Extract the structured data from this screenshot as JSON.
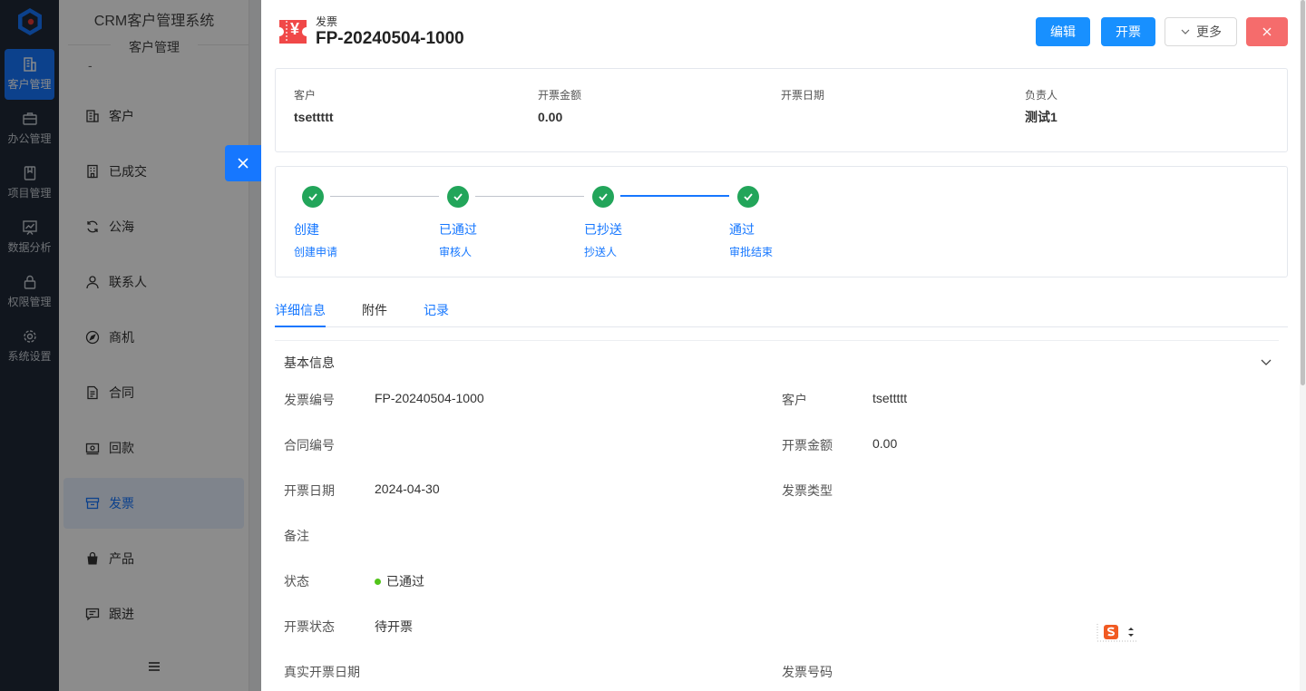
{
  "rail": {
    "items": [
      {
        "label": "客户管理",
        "icon": "building-icon",
        "active": true
      },
      {
        "label": "办公管理",
        "icon": "briefcase-icon"
      },
      {
        "label": "项目管理",
        "icon": "book-icon"
      },
      {
        "label": "数据分析",
        "icon": "chart-icon"
      },
      {
        "label": "权限管理",
        "icon": "lock-icon"
      },
      {
        "label": "系统设置",
        "icon": "gear-icon"
      }
    ]
  },
  "submenu": {
    "system_title": "CRM客户管理系统",
    "section_title": "客户管理",
    "dash": "-",
    "items": [
      {
        "label": "客户",
        "icon": "building-icon"
      },
      {
        "label": "已成交",
        "icon": "office-icon"
      },
      {
        "label": "公海",
        "icon": "refresh-icon"
      },
      {
        "label": "联系人",
        "icon": "user-icon"
      },
      {
        "label": "商机",
        "icon": "compass-icon"
      },
      {
        "label": "合同",
        "icon": "document-icon"
      },
      {
        "label": "回款",
        "icon": "money-icon"
      },
      {
        "label": "发票",
        "icon": "invoice-box-icon",
        "active": true
      },
      {
        "label": "产品",
        "icon": "bag-icon"
      },
      {
        "label": "跟进",
        "icon": "message-icon"
      }
    ]
  },
  "drawer": {
    "type_label": "发票",
    "title": "FP-20240504-1000",
    "icon_glyph": "¥",
    "buttons": {
      "edit": "编辑",
      "issue": "开票",
      "more": "更多"
    },
    "summary": [
      {
        "label": "客户",
        "value": "tsettttt"
      },
      {
        "label": "开票金额",
        "value": "0.00"
      },
      {
        "label": "开票日期",
        "value": ""
      },
      {
        "label": "负责人",
        "value": "测试1"
      }
    ],
    "steps": [
      {
        "name": "创建",
        "sub": "创建申请"
      },
      {
        "name": "已通过",
        "sub": "审核人"
      },
      {
        "name": "已抄送",
        "sub": "抄送人"
      },
      {
        "name": "通过",
        "sub": "审批结束"
      }
    ],
    "tabs": [
      "详细信息",
      "附件",
      "记录"
    ],
    "section_title": "基本信息",
    "fields_left": [
      {
        "label": "发票编号",
        "value": "FP-20240504-1000"
      },
      {
        "label": "合同编号",
        "value": ""
      },
      {
        "label": "开票日期",
        "value": "2024-04-30"
      },
      {
        "label": "备注",
        "value": ""
      },
      {
        "label": "状态",
        "value": "已通过"
      },
      {
        "label": "开票状态",
        "value": "待开票"
      },
      {
        "label": "真实开票日期",
        "value": ""
      }
    ],
    "fields_right": [
      {
        "label": "客户",
        "value": "tsettttt"
      },
      {
        "label": "开票金额",
        "value": "0.00"
      },
      {
        "label": "发票类型",
        "value": ""
      },
      {
        "label": "发票号码",
        "value": ""
      }
    ],
    "colors": {
      "primary": "#1890ff",
      "success": "#22a55a",
      "danger": "#f56c6c"
    }
  }
}
